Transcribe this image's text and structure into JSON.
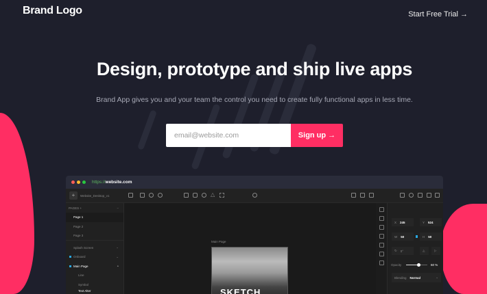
{
  "header": {
    "logo": "Brand Logo",
    "cta": "Start Free Trial →"
  },
  "hero": {
    "title": "Design, prototype and ship live apps",
    "subtitle": "Brand App gives you and your team the control you need to create fully functional apps in less time.",
    "email_placeholder": "email@website.com",
    "signup": "Sign up →"
  },
  "app": {
    "url_protocol": "https://",
    "url_host": "website.com",
    "file_name": "Website_Desktop_v1",
    "pages_header": "PAGES +",
    "layers": [
      {
        "label": "Page 1"
      },
      {
        "label": "Page 2"
      },
      {
        "label": "Page 3"
      },
      {
        "label": "Splash Screen"
      },
      {
        "label": "Onboard"
      },
      {
        "label": "Main Page"
      },
      {
        "label": "Line"
      },
      {
        "label": "Symbol"
      },
      {
        "label": "Text Alter"
      }
    ],
    "canvas_label": "Main Page",
    "artboard_text": "SKETCH",
    "props": {
      "x_label": "X",
      "x": "245",
      "y_label": "Y",
      "y": "524",
      "w_label": "W",
      "w": "50",
      "h_label": "H",
      "h": "50",
      "rotation": "0°",
      "opacity_label": "Opacity",
      "opacity": "60 %",
      "opacity_value": 0.6,
      "blending_label": "Blending",
      "blending": "Normal"
    }
  },
  "colors": {
    "bg": "#1e1f2c",
    "accent": "#ff2e63"
  }
}
